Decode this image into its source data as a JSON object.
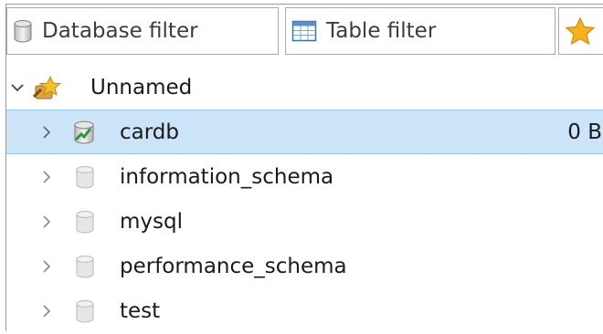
{
  "filters": {
    "database_placeholder": "Database filter",
    "table_placeholder": "Table filter",
    "favorites_icon": "star-icon"
  },
  "tree": {
    "session": {
      "label": "Unnamed",
      "icon": "session-icon",
      "expanded": true
    },
    "databases": [
      {
        "label": "cardb",
        "size": "0 B",
        "selected": true,
        "icon": "database-active-icon"
      },
      {
        "label": "information_schema",
        "size": "",
        "selected": false,
        "icon": "database-icon"
      },
      {
        "label": "mysql",
        "size": "",
        "selected": false,
        "icon": "database-icon"
      },
      {
        "label": "performance_schema",
        "size": "",
        "selected": false,
        "icon": "database-icon"
      },
      {
        "label": "test",
        "size": "",
        "selected": false,
        "icon": "database-icon"
      }
    ]
  },
  "colors": {
    "selection": "#cce4f7",
    "selection_border": "#99c9ef"
  }
}
